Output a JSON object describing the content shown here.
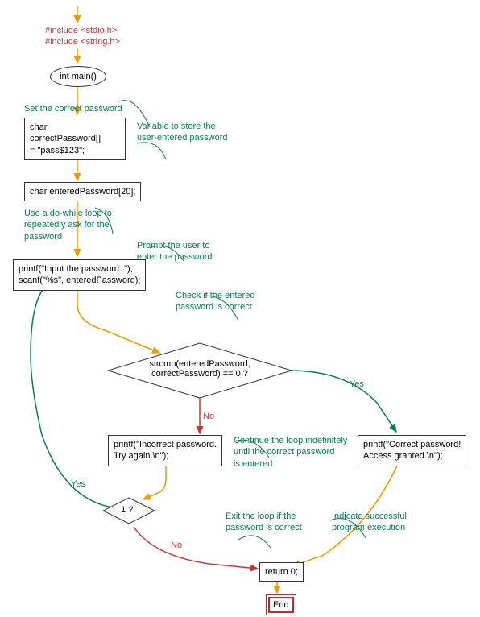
{
  "chart_data": {
    "type": "flowchart",
    "title": "",
    "nodes": [
      {
        "id": "includes",
        "type": "code",
        "text": "#include <stdio.h>\n#include <string.h>"
      },
      {
        "id": "main",
        "type": "terminal",
        "text": "int main()"
      },
      {
        "id": "setpass_ann",
        "type": "annotation",
        "text": "Set the correct password"
      },
      {
        "id": "correct",
        "type": "process",
        "text": "char correctPassword[]\n= \"pass$123\";"
      },
      {
        "id": "var_ann",
        "type": "annotation",
        "text": "Variable to store the\nuser-entered password"
      },
      {
        "id": "entered",
        "type": "process",
        "text": "char enteredPassword[20];"
      },
      {
        "id": "loop_ann",
        "type": "annotation",
        "text": "Use a do-while loop to\nrepeatedly ask for the\npassword"
      },
      {
        "id": "prompt_ann",
        "type": "annotation",
        "text": "Prompt the user to\nenter the password"
      },
      {
        "id": "input",
        "type": "process",
        "text": "printf(\"Input the password: \");\nscanf(\"%s\", enteredPassword);"
      },
      {
        "id": "check_ann",
        "type": "annotation",
        "text": "Check if the entered\npassword is correct"
      },
      {
        "id": "decision",
        "type": "decision",
        "text": "strcmp(enteredPassword,\ncorrectPassword) == 0 ?"
      },
      {
        "id": "incorrect",
        "type": "process",
        "text": "printf(\"Incorrect password.\nTry again.\\n\");"
      },
      {
        "id": "continue_ann",
        "type": "annotation",
        "text": "Continue the loop indefinitely\nuntil the correct password\nis entered"
      },
      {
        "id": "correctmsg",
        "type": "process",
        "text": "printf(\"Correct password!\nAccess granted.\\n\");"
      },
      {
        "id": "loopcond",
        "type": "decision",
        "text": "1 ?"
      },
      {
        "id": "exit_ann",
        "type": "annotation",
        "text": "Exit the loop if the\npassword is correct"
      },
      {
        "id": "success_ann",
        "type": "annotation",
        "text": "Indicate successful\nprogram execution"
      },
      {
        "id": "return",
        "type": "process",
        "text": "return 0;"
      },
      {
        "id": "end",
        "type": "terminal",
        "text": "End"
      }
    ],
    "edges": [
      {
        "from": "start",
        "to": "includes"
      },
      {
        "from": "includes",
        "to": "main"
      },
      {
        "from": "main",
        "to": "correct"
      },
      {
        "from": "correct",
        "to": "entered"
      },
      {
        "from": "entered",
        "to": "input"
      },
      {
        "from": "input",
        "to": "decision"
      },
      {
        "from": "decision",
        "to": "incorrect",
        "label": "No"
      },
      {
        "from": "decision",
        "to": "correctmsg",
        "label": "Yes"
      },
      {
        "from": "incorrect",
        "to": "loopcond"
      },
      {
        "from": "loopcond",
        "to": "input",
        "label": "Yes"
      },
      {
        "from": "loopcond",
        "to": "return",
        "label": "No"
      },
      {
        "from": "correctmsg",
        "to": "return"
      },
      {
        "from": "return",
        "to": "end"
      }
    ]
  },
  "nodes": {
    "inc1": "#include <stdio.h>",
    "inc2": "#include <string.h>",
    "main": "int main()",
    "correct": "char correctPassword[]\n= \"pass$123\";",
    "entered": "char enteredPassword[20];",
    "input": "printf(\"Input the password: \");\nscanf(\"%s\", enteredPassword);",
    "decision": "strcmp(enteredPassword,\ncorrectPassword) == 0 ?",
    "incorrect": "printf(\"Incorrect password.\nTry again.\\n\");",
    "correctmsg": "printf(\"Correct password!\nAccess granted.\\n\");",
    "loopcond": "1 ?",
    "ret": "return 0;",
    "end": "End"
  },
  "ann": {
    "setpass": "Set the correct password",
    "var": "Variable to store the\nuser-entered password",
    "loop": "Use a do-while loop to\nrepeatedly ask for the\npassword",
    "prompt": "Prompt the user to\nenter the password",
    "check": "Check if the entered\npassword is correct",
    "cont": "Continue the loop indefinitely\nuntil the correct password\nis entered",
    "exit": "Exit the loop if the\npassword is correct",
    "success": "Indicate successful\nprogram execution"
  },
  "labels": {
    "yes": "Yes",
    "no": "No"
  }
}
